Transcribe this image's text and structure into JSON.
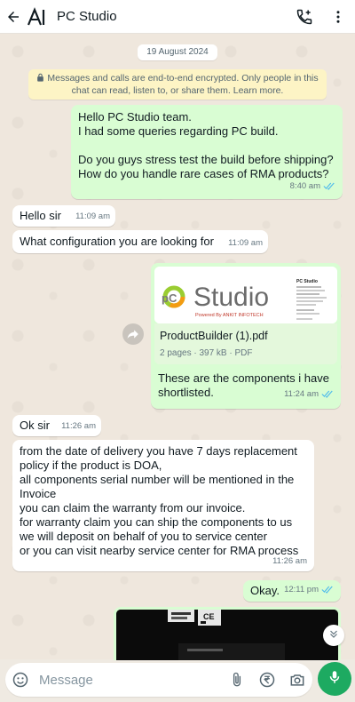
{
  "header": {
    "title": "PC Studio",
    "logo_text": "AI"
  },
  "date_chip": "19 August 2024",
  "encryption_note": "Messages and calls are end-to-end encrypted. Only people in this chat can read, listen to, or share them. Learn more.",
  "messages": [
    {
      "direction": "out",
      "lines": [
        "Hello PC Studio team.",
        "I had some queries regarding PC build.",
        "",
        "Do you guys stress test the build before shipping?",
        "How do you handle rare cases of RMA products?"
      ],
      "time": "8:40 am"
    },
    {
      "direction": "in",
      "lines": [
        "Hello sir"
      ],
      "time": "11:09 am"
    },
    {
      "direction": "in",
      "lines": [
        "What configuration you are looking for"
      ],
      "time": "11:09 am"
    },
    {
      "direction": "out",
      "attachment": {
        "brand": "Studio",
        "brand_prefix": "pC",
        "brand_sub": "Powered By ANKIT INFOTECH",
        "sidebar_title": "PC Studio",
        "file_name": "ProductBuilder (1).pdf",
        "file_meta": "2 pages · 397 kB · PDF"
      },
      "lines": [
        "These are the components i have",
        "shortlisted."
      ],
      "time": "11:24 am"
    },
    {
      "direction": "in",
      "lines": [
        "Ok sir"
      ],
      "time": "11:26 am"
    },
    {
      "direction": "in",
      "lines": [
        "from the date of delivery you have 7 days replacement",
        "policy if the product is DOA,",
        "all components serial number will be mentioned in the",
        "Invoice",
        "you can claim the warranty from our invoice.",
        "for warranty claim you can ship the components to us",
        "we will deposit on behalf of you to service center",
        "or you can visit nearby service center for RMA process"
      ],
      "time": "11:26 am"
    },
    {
      "direction": "out",
      "lines": [
        "Okay."
      ],
      "time": "12:11 pm"
    }
  ],
  "image_labels": [
    "CE"
  ],
  "composer": {
    "placeholder": "Message"
  },
  "colors": {
    "outgoing_bubble": "#d9fdd3",
    "incoming_bubble": "#ffffff",
    "accent": "#1daa61",
    "read_ticks": "#53bdeb"
  },
  "icons": [
    "back-arrow-icon",
    "add-call-icon",
    "more-vert-icon",
    "lock-icon",
    "double-check-icon",
    "forward-icon",
    "chevron-down-icon",
    "sticker-icon",
    "attach-icon",
    "rupee-icon",
    "camera-icon",
    "mic-icon"
  ]
}
